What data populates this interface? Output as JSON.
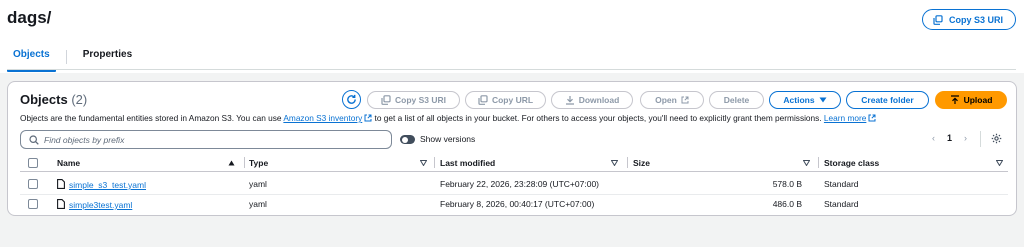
{
  "header": {
    "title": "dags/",
    "copy_uri_label": "Copy S3 URI",
    "tabs": [
      {
        "label": "Objects",
        "active": true
      },
      {
        "label": "Properties",
        "active": false
      }
    ]
  },
  "objects_panel": {
    "title": "Objects",
    "count": "(2)",
    "toolbar": {
      "refresh_icon": "refresh-icon",
      "copy_s3_uri": "Copy S3 URI",
      "copy_url": "Copy URL",
      "download": "Download",
      "open": "Open",
      "delete": "Delete",
      "actions": "Actions",
      "create_folder": "Create folder",
      "upload": "Upload"
    },
    "description": {
      "before": "Objects are the fundamental entities stored in Amazon S3. You can use ",
      "inventory_link": "Amazon S3 inventory",
      "middle": " to get a list of all objects in your bucket. For others to access your objects, you'll need to explicitly grant them permissions. ",
      "learn_more": "Learn more"
    },
    "search": {
      "placeholder": "Find objects by prefix"
    },
    "show_versions": "Show versions",
    "pagination": {
      "current_page": "1"
    },
    "columns": [
      "Name",
      "Type",
      "Last modified",
      "Size",
      "Storage class"
    ],
    "rows": [
      {
        "name": "simple_s3_test.yaml",
        "type": "yaml",
        "last_modified": "February 22, 2026, 23:28:09 (UTC+07:00)",
        "size": "578.0 B",
        "storage_class": "Standard"
      },
      {
        "name": "simple3test.yaml",
        "type": "yaml",
        "last_modified": "February 8, 2026, 00:40:17 (UTC+07:00)",
        "size": "486.0 B",
        "storage_class": "Standard"
      }
    ]
  },
  "colors": {
    "accent": "#0972d3",
    "upload": "#ff9900",
    "disabled": "#8d99a8"
  }
}
